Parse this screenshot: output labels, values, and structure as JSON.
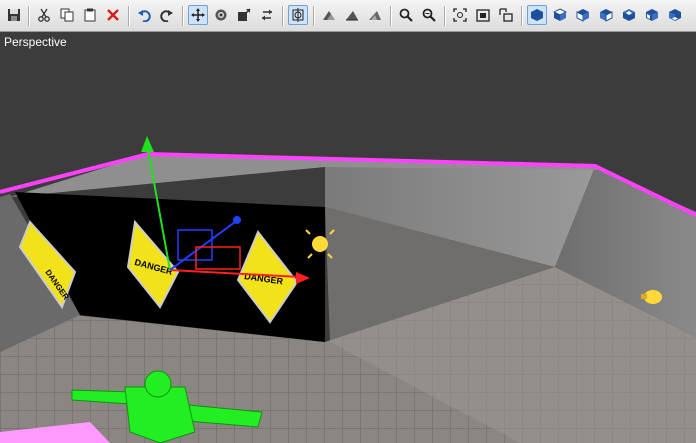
{
  "toolbar": {
    "buttons": [
      {
        "id": "save",
        "icon": "save-icon",
        "glyph": "💾"
      },
      {
        "id": "cut",
        "icon": "cut-icon",
        "glyph": "✂"
      },
      {
        "id": "copy",
        "icon": "copy-icon",
        "glyph": "⧉"
      },
      {
        "id": "paste",
        "icon": "paste-icon",
        "glyph": "📋"
      },
      {
        "id": "delete",
        "icon": "delete-icon",
        "glyph": "✕"
      },
      {
        "id": "undo",
        "icon": "undo-icon",
        "glyph": "↶"
      },
      {
        "id": "redo",
        "icon": "redo-icon",
        "glyph": "↷"
      },
      {
        "id": "move",
        "icon": "move-icon",
        "glyph": "✥"
      },
      {
        "id": "rotate",
        "icon": "rotate-icon",
        "glyph": "⟳"
      },
      {
        "id": "scale",
        "icon": "scale-icon",
        "glyph": "⤢"
      },
      {
        "id": "mirror",
        "icon": "mirror-icon",
        "glyph": "⇆"
      },
      {
        "id": "snap",
        "icon": "snap-icon",
        "glyph": "⌖"
      },
      {
        "id": "terrain-a",
        "icon": "terrain-icon",
        "glyph": "◭"
      },
      {
        "id": "terrain-b",
        "icon": "terrain-icon",
        "glyph": "◭"
      },
      {
        "id": "terrain-c",
        "icon": "terrain-icon",
        "glyph": "◭"
      },
      {
        "id": "zoom-in",
        "icon": "zoom-in-icon",
        "glyph": "🔍"
      },
      {
        "id": "zoom-out",
        "icon": "zoom-out-icon",
        "glyph": "🔍"
      },
      {
        "id": "frame",
        "icon": "frame-icon",
        "glyph": "⊡"
      },
      {
        "id": "maximize",
        "icon": "maximize-icon",
        "glyph": "⧠"
      },
      {
        "id": "restore",
        "icon": "restore-icon",
        "glyph": "⧉"
      },
      {
        "id": "view-perspective",
        "icon": "cube-icon",
        "glyph": "⬢"
      },
      {
        "id": "view-top",
        "icon": "cube-icon",
        "glyph": "⬢"
      },
      {
        "id": "view-front",
        "icon": "cube-icon",
        "glyph": "⬢"
      },
      {
        "id": "view-side",
        "icon": "cube-icon",
        "glyph": "⬢"
      },
      {
        "id": "view-back",
        "icon": "cube-icon",
        "glyph": "⬢"
      },
      {
        "id": "view-left",
        "icon": "cube-icon",
        "glyph": "⬢"
      },
      {
        "id": "view-bottom",
        "icon": "cube-icon",
        "glyph": "⬢"
      }
    ],
    "colors": {
      "delete": "#d42020",
      "undo": "#1a5fb4",
      "cube": "#1c4f9c",
      "active_bg": "#cfe3f7"
    }
  },
  "viewport": {
    "label": "Perspective",
    "signs": [
      "DANGER",
      "DANGER",
      "DANGER"
    ],
    "colors": {
      "background": "#3c3c3c",
      "edge": "#ff40ff",
      "gizmo_x": "#ff2020",
      "gizmo_y": "#20e020",
      "gizmo_z": "#2040ff",
      "figure": "#22ee22"
    }
  }
}
